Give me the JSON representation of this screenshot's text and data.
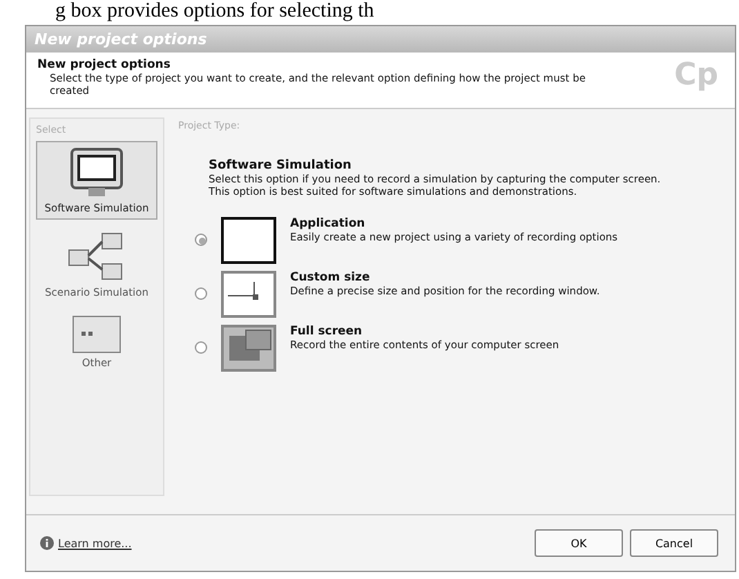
{
  "page_text": "g box provides options for selecting th",
  "window": {
    "title": "New project options"
  },
  "header": {
    "title": "New project options",
    "description": "Select the type of project you want to create, and the relevant option defining how the project must be created",
    "logo": "Cp"
  },
  "sidebar": {
    "label": "Select",
    "items": [
      {
        "label": "Software Simulation",
        "kind": "monitor",
        "selected": true
      },
      {
        "label": "Scenario Simulation",
        "kind": "branch",
        "selected": false
      },
      {
        "label": "Other",
        "kind": "other",
        "selected": false
      }
    ]
  },
  "project_type": {
    "label": "Project Type:",
    "heading": "Software Simulation",
    "description": "Select this option if you need to record a simulation by capturing the computer screen. This option is best suited for software simulations and demonstrations.",
    "options": [
      {
        "title": "Application",
        "description": "Easily create a new project using a variety of recording options",
        "kind": "application",
        "selected": true
      },
      {
        "title": "Custom size",
        "description": "Define a precise size and position for the recording window.",
        "kind": "custom",
        "selected": false
      },
      {
        "title": "Full screen",
        "description": "Record the entire contents of your computer screen",
        "kind": "full",
        "selected": false
      }
    ]
  },
  "footer": {
    "link": "Learn more...",
    "buttons": [
      "OK",
      "Cancel"
    ]
  }
}
